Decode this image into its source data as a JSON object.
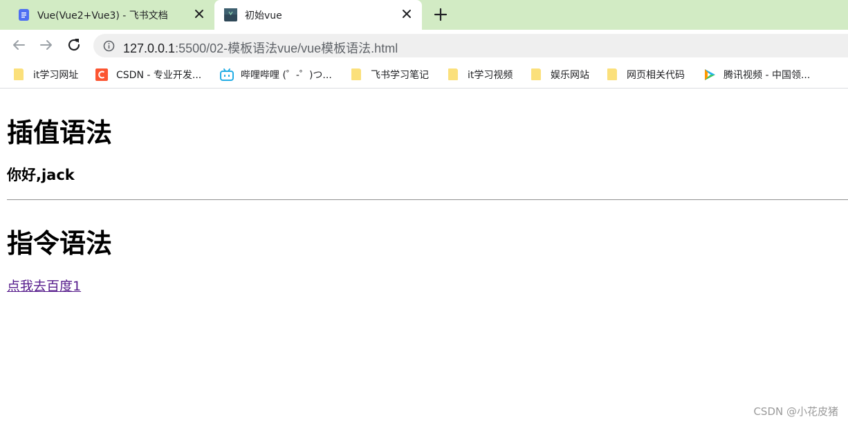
{
  "tabs": [
    {
      "title": "Vue(Vue2+Vue3) - 飞书文档",
      "icon": "doc-icon",
      "active": false
    },
    {
      "title": "初始vue",
      "icon": "vue-favicon",
      "active": true
    }
  ],
  "toolbar": {
    "url_host": "127.0.0.1",
    "url_rest": ":5500/02-模板语法vue/vue模板语法.html"
  },
  "bookmarks": [
    {
      "label": "it学习网址",
      "icon": "folder-icon"
    },
    {
      "label": "CSDN - 专业开发...",
      "icon": "csdn-icon"
    },
    {
      "label": "哔哩哔哩 (゜-゜)つ...",
      "icon": "bilibili-icon"
    },
    {
      "label": "飞书学习笔记",
      "icon": "folder-icon"
    },
    {
      "label": "it学习视频",
      "icon": "folder-icon"
    },
    {
      "label": "娱乐网站",
      "icon": "folder-icon"
    },
    {
      "label": "网页相关代码",
      "icon": "folder-icon"
    },
    {
      "label": "腾讯视频 - 中国领...",
      "icon": "tencent-video-icon"
    }
  ],
  "content": {
    "heading_interpolation": "插值语法",
    "greeting": "你好,jack",
    "heading_directive": "指令语法",
    "link_text": "点我去百度1"
  },
  "watermark": "CSDN @小花皮猪",
  "colors": {
    "tabstrip": "#d2ebc4",
    "omnibox": "#efefef",
    "visited_link": "#551a8b"
  }
}
